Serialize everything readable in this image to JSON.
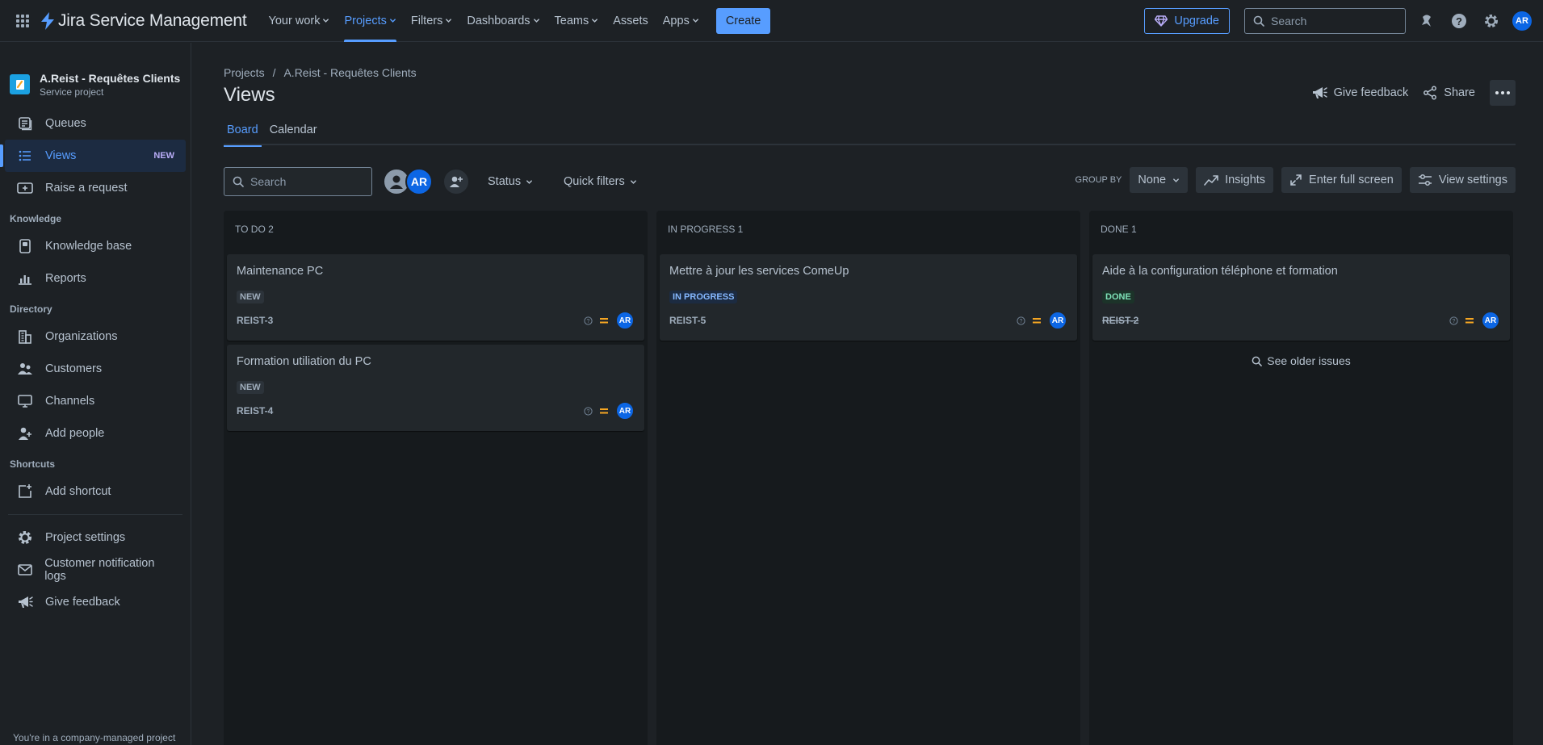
{
  "topnav": {
    "product": "Jira Service Management",
    "items": [
      {
        "label": "Your work",
        "dropdown": true,
        "active": false
      },
      {
        "label": "Projects",
        "dropdown": true,
        "active": true
      },
      {
        "label": "Filters",
        "dropdown": true,
        "active": false
      },
      {
        "label": "Dashboards",
        "dropdown": true,
        "active": false
      },
      {
        "label": "Teams",
        "dropdown": true,
        "active": false
      },
      {
        "label": "Assets",
        "dropdown": false,
        "active": false
      },
      {
        "label": "Apps",
        "dropdown": true,
        "active": false
      }
    ],
    "create_label": "Create",
    "upgrade_label": "Upgrade",
    "search_placeholder": "Search",
    "user_initials": "AR"
  },
  "sidebar": {
    "project_name": "A.Reist - Requêtes Clients",
    "project_type": "Service project",
    "items": [
      {
        "label": "Queues",
        "icon": "queues-icon"
      },
      {
        "label": "Views",
        "icon": "list-icon",
        "badge": "NEW",
        "active": true
      },
      {
        "label": "Raise a request",
        "icon": "raise-request-icon"
      }
    ],
    "knowledge_title": "Knowledge",
    "knowledge_items": [
      {
        "label": "Knowledge base",
        "icon": "knowledge-base-icon"
      },
      {
        "label": "Reports",
        "icon": "reports-icon"
      }
    ],
    "directory_title": "Directory",
    "directory_items": [
      {
        "label": "Organizations",
        "icon": "organizations-icon"
      },
      {
        "label": "Customers",
        "icon": "customers-icon"
      },
      {
        "label": "Channels",
        "icon": "channels-icon"
      },
      {
        "label": "Add people",
        "icon": "add-people-icon"
      }
    ],
    "shortcuts_title": "Shortcuts",
    "shortcuts_items": [
      {
        "label": "Add shortcut",
        "icon": "add-shortcut-icon"
      }
    ],
    "bottom_items": [
      {
        "label": "Project settings",
        "icon": "gear-icon"
      },
      {
        "label": "Customer notification logs",
        "icon": "mail-icon"
      },
      {
        "label": "Give feedback",
        "icon": "megaphone-icon"
      }
    ],
    "footer": "You're in a company-managed project"
  },
  "main": {
    "breadcrumb": [
      "Projects",
      "/",
      "A.Reist - Requêtes Clients"
    ],
    "title": "Views",
    "give_feedback": "Give feedback",
    "share": "Share",
    "tabs": [
      {
        "label": "Board",
        "active": true
      },
      {
        "label": "Calendar",
        "active": false
      }
    ],
    "toolbar": {
      "search_placeholder": "Search",
      "assignee_initials": "AR",
      "status_label": "Status",
      "quick_filters_label": "Quick filters",
      "group_by_label": "GROUP BY",
      "group_by_value": "None",
      "insights_label": "Insights",
      "full_screen_label": "Enter full screen",
      "view_settings_label": "View settings"
    },
    "columns": [
      {
        "title": "TO DO 2",
        "cards": [
          {
            "title": "Maintenance PC",
            "status": "NEW",
            "status_kind": "new",
            "key": "REIST-3",
            "assignee": "AR"
          },
          {
            "title": "Formation utiliation du PC",
            "status": "NEW",
            "status_kind": "new",
            "key": "REIST-4",
            "assignee": "AR"
          }
        ]
      },
      {
        "title": "IN PROGRESS 1",
        "cards": [
          {
            "title": "Mettre à jour les services ComeUp",
            "status": "IN PROGRESS",
            "status_kind": "prog",
            "key": "REIST-5",
            "assignee": "AR"
          }
        ]
      },
      {
        "title": "DONE 1",
        "cards": [
          {
            "title": "Aide à la configuration téléphone et formation",
            "status": "DONE",
            "status_kind": "done",
            "key": "REIST-2",
            "assignee": "AR",
            "strike": true
          }
        ],
        "older_label": "See older issues"
      }
    ]
  }
}
